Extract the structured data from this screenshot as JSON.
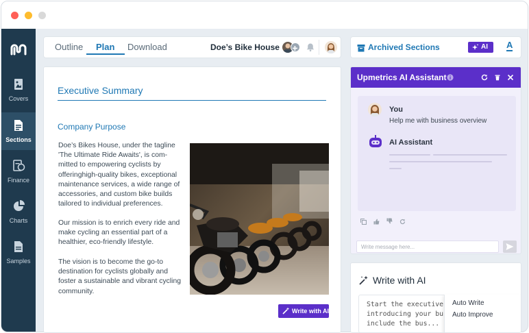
{
  "window_controls": {
    "close_color": "#ff5f57",
    "minimize_color": "#febc2e",
    "zoom_color": "#d9d9d9"
  },
  "sidebar": {
    "items": [
      {
        "label": "Covers",
        "icon": "image-icon"
      },
      {
        "label": "Sections",
        "icon": "document-icon",
        "active": true
      },
      {
        "label": "Finance",
        "icon": "finance-icon"
      },
      {
        "label": "Charts",
        "icon": "pie-chart-icon"
      },
      {
        "label": "Samples",
        "icon": "file-icon"
      }
    ]
  },
  "topbar": {
    "tabs": [
      "Outline",
      "Plan",
      "Download"
    ],
    "active_tab": "Plan",
    "business_name": "Doe’s Bike House"
  },
  "document": {
    "title": "Executive Summary",
    "subtitle": "Company Purpose",
    "paragraphs": [
      "Doe’s Bikes House, under the tagline 'The Ultimate Ride Awaits', is com-mitted to empowering cyclists by offeringhigh-quality bikes, exceptional maintenance services, a wide range of accessories, and custom bike builds tailored to individual preferences.",
      "Our mission is to enrich every ride and make cycling an essential part of a healthier, eco-friendly lifestyle.",
      "The vision is to become the go-to destination for cyclists globally and foster a sustainable and vibrant cycling community."
    ],
    "write_button": "Write with AI"
  },
  "archived": {
    "label": "Archived Sections",
    "ai_badge": "AI",
    "font_button": "A"
  },
  "assistant": {
    "title": "Upmetrics AI Assistant",
    "user_name": "You",
    "user_message": "Help me with business overview",
    "ai_name": "AI Assistant",
    "input_placeholder": "Write message here...",
    "accent": "#5b2fc9"
  },
  "write_ai": {
    "title": "Write with AI",
    "prompt_text": "Start the executive sum... introducing your busin... may include the bus...",
    "menu": [
      "Auto Write",
      "Auto Improve"
    ]
  }
}
